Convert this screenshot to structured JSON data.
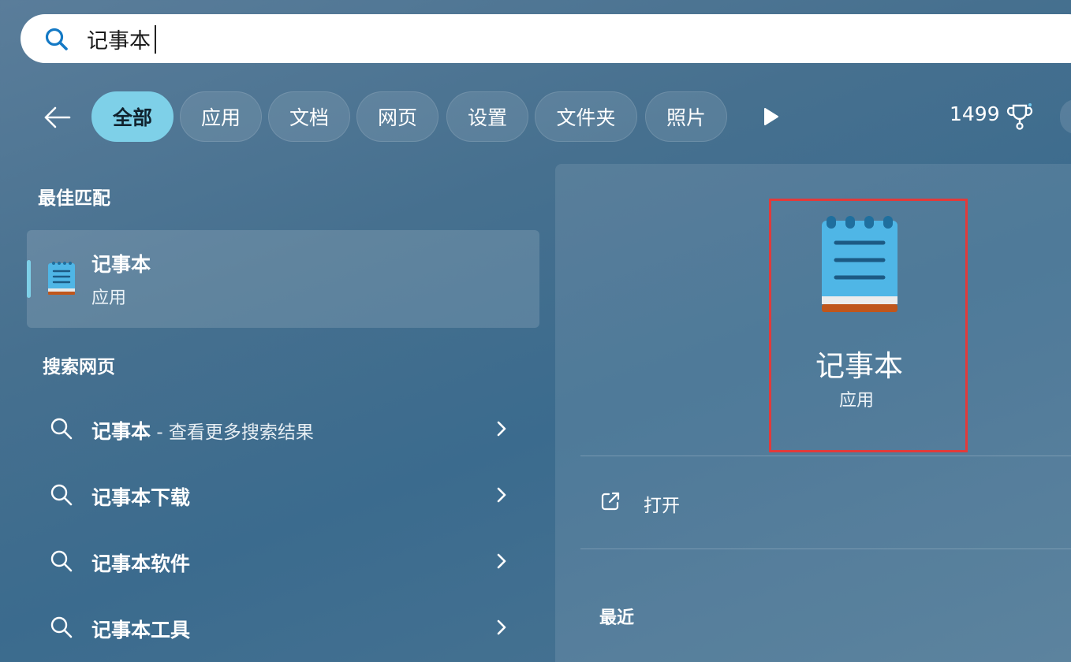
{
  "search": {
    "value": "记事本",
    "icon": "search-icon"
  },
  "filters": {
    "back_icon": "back-arrow-icon",
    "chips": [
      {
        "label": "全部",
        "active": true
      },
      {
        "label": "应用",
        "active": false
      },
      {
        "label": "文档",
        "active": false
      },
      {
        "label": "网页",
        "active": false
      },
      {
        "label": "设置",
        "active": false
      },
      {
        "label": "文件夹",
        "active": false
      },
      {
        "label": "照片",
        "active": false
      }
    ],
    "more_icon": "play-icon",
    "points": "1499",
    "trophy_icon": "trophy-icon"
  },
  "best_match": {
    "section": "最佳匹配",
    "title": "记事本",
    "subtitle": "应用",
    "icon": "notepad-icon"
  },
  "web_search": {
    "section": "搜索网页",
    "items": [
      {
        "text": "记事本",
        "extra": " - 查看更多搜索结果"
      },
      {
        "text": "记事本下载",
        "extra": ""
      },
      {
        "text": "记事本软件",
        "extra": ""
      },
      {
        "text": "记事本工具",
        "extra": ""
      }
    ]
  },
  "detail": {
    "title": "记事本",
    "subtitle": "应用",
    "highlight_color": "#e23a3a",
    "open_label": "打开",
    "recent_label": "最近"
  },
  "colors": {
    "accent": "#7ed0e8",
    "notepad_blue": "#4fb6e6",
    "notepad_band": "#c0561b"
  }
}
